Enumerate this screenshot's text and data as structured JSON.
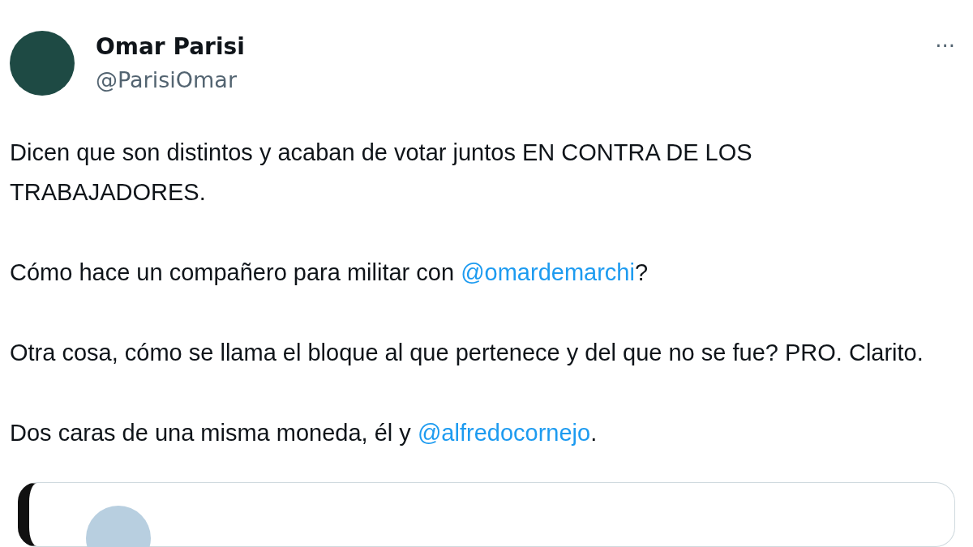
{
  "author": {
    "name": "Omar Parisi",
    "handle": "@ParisiOmar"
  },
  "menu": "···",
  "paragraphs": [
    [
      {
        "kind": "text",
        "text": "Dicen que son distintos y acaban de votar juntos EN CONTRA DE LOS TRABAJADORES."
      }
    ],
    [
      {
        "kind": "text",
        "text": "Cómo hace un compañero para militar con "
      },
      {
        "kind": "mention",
        "text": "@omardemarchi"
      },
      {
        "kind": "text",
        "text": "?"
      }
    ],
    [
      {
        "kind": "text",
        "text": "Otra cosa, cómo se llama el bloque al que pertenece y del que no se fue? PRO. Clarito."
      }
    ],
    [
      {
        "kind": "text",
        "text": "Dos caras de una misma moneda, él y "
      },
      {
        "kind": "mention",
        "text": "@alfredocornejo"
      },
      {
        "kind": "text",
        "text": "."
      }
    ]
  ]
}
